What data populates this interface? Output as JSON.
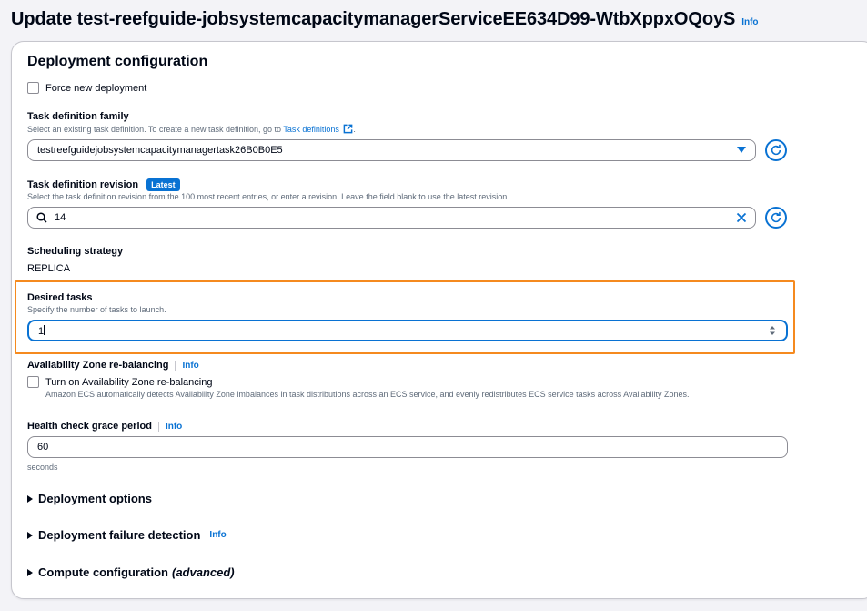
{
  "header": {
    "title": "Update test-reefguide-jobsystemcapacitymanagerServiceEE634D99-WtbXppxOQoyS",
    "info_label": "Info"
  },
  "deployment_configuration": {
    "title": "Deployment configuration",
    "force_new_deployment": {
      "label": "Force new deployment",
      "checked": false
    },
    "task_definition_family": {
      "label": "Task definition family",
      "description": "Select an existing task definition. To create a new task definition, go to",
      "link_text": "Task definitions",
      "description_suffix": ".",
      "value": "testreefguidejobsystemcapacitymanagertask26B0B0E5"
    },
    "task_definition_revision": {
      "label": "Task definition revision",
      "badge": "Latest",
      "description": "Select the task definition revision from the 100 most recent entries, or enter a revision. Leave the field blank to use the latest revision.",
      "value": "14"
    },
    "scheduling_strategy": {
      "label": "Scheduling strategy",
      "value": "REPLICA"
    },
    "desired_tasks": {
      "label": "Desired tasks",
      "description": "Specify the number of tasks to launch.",
      "value": "1"
    },
    "az_rebalancing": {
      "label": "Availability Zone re-balancing",
      "info_label": "Info",
      "checkbox_label": "Turn on Availability Zone re-balancing",
      "checkbox_description": "Amazon ECS automatically detects Availability Zone imbalances in task distributions across an ECS service, and evenly redistributes ECS service tasks across Availability Zones.",
      "checked": false
    },
    "health_check_grace_period": {
      "label": "Health check grace period",
      "info_label": "Info",
      "value": "60",
      "unit": "seconds"
    }
  },
  "expandable_sections": {
    "deployment_options": {
      "label": "Deployment options"
    },
    "deployment_failure_detection": {
      "label": "Deployment failure detection",
      "info_label": "Info"
    },
    "compute_configuration": {
      "label": "Compute configuration",
      "suffix": "(advanced)"
    }
  },
  "colors": {
    "accent": "#0972d3",
    "highlight": "#f58a1f",
    "border": "#8c8c94"
  }
}
